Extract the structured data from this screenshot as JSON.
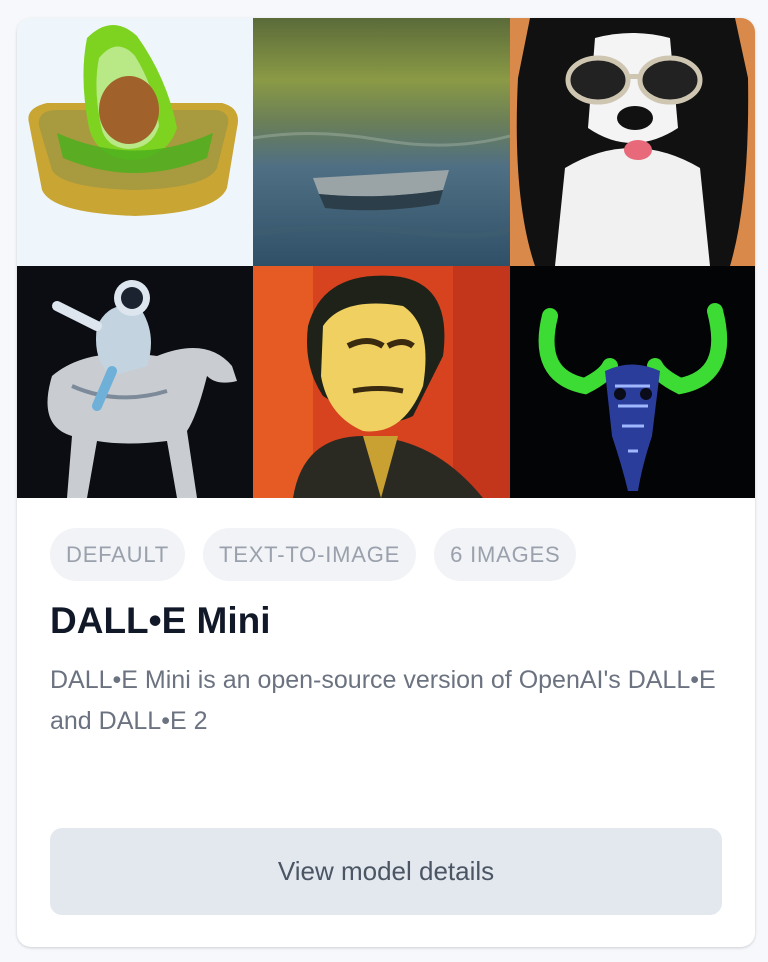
{
  "images": [
    {
      "name": "avocado-armchair"
    },
    {
      "name": "boat-on-lake"
    },
    {
      "name": "dog-with-sunglasses"
    },
    {
      "name": "astronaut-riding-horse"
    },
    {
      "name": "portrait-painting"
    },
    {
      "name": "neon-skull"
    }
  ],
  "tags": [
    "DEFAULT",
    "TEXT-TO-IMAGE",
    "6 IMAGES"
  ],
  "title": "DALL•E Mini",
  "description": "DALL•E Mini is an open-source version of OpenAI's DALL•E and DALL•E 2",
  "button_label": "View model details"
}
